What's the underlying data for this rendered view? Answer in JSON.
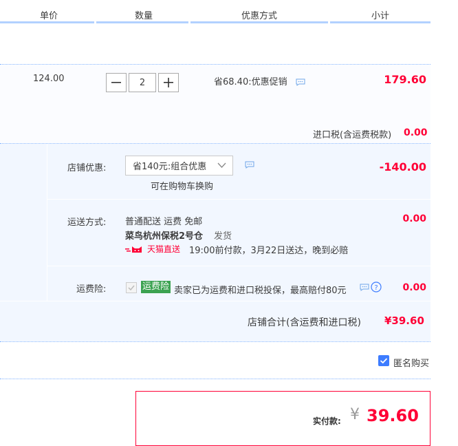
{
  "header": {
    "unit_price": "单价",
    "quantity": "数量",
    "discount": "优惠方式",
    "subtotal": "小计"
  },
  "item": {
    "unit_price": "124.00",
    "quantity": "2",
    "discount_text": "省68.40:优惠促销",
    "subtotal": "179.60",
    "tax_label": "进口税(含运费税款)",
    "tax_value": "0.00"
  },
  "store_discount": {
    "label": "店铺优惠:",
    "selected": "省140元:组合优惠",
    "note": "可在购物车换购",
    "amount": "-140.00"
  },
  "shipping": {
    "label": "运送方式:",
    "method": "普通配送 运费 免邮",
    "warehouse": "菜鸟杭州保税2号仓",
    "dispatch": "发货",
    "badge": "天猫直送",
    "delivery_note": "19:00前付款，3月22日送达，晚到必赔",
    "amount": "0.00"
  },
  "insurance": {
    "label": "运费险:",
    "badge": "运费险",
    "text": "卖家已为运费和进口税投保，最高赔付80元",
    "amount": "0.00"
  },
  "store_total": {
    "label": "店铺合计(含运费和进口税)",
    "value": "¥39.60"
  },
  "anonymous": {
    "label": "匿名购买",
    "checked": true
  },
  "payment": {
    "label": "实付款:",
    "currency": "¥",
    "amount": "39.60"
  },
  "colors": {
    "accent_red": "#ff0036",
    "header_line": "#b2d1ff",
    "checkbox_blue": "#3d7cff",
    "badge_green": "#3ba251"
  }
}
